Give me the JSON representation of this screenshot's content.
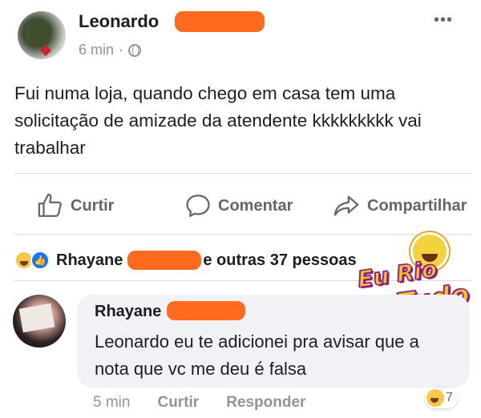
{
  "post": {
    "author": "Leonardo",
    "time": "6 min",
    "separator": "·",
    "more": "•••",
    "text": "Fui numa loja, quando chego em casa tem uma solicitação de amizade da atendente kkkkkkkkk vai trabalhar"
  },
  "actions": {
    "like": "Curtir",
    "comment": "Comentar",
    "share": "Compartilhar"
  },
  "reactions": {
    "name": "Rhayane",
    "others": "e outras 37 pessoas"
  },
  "watermark": {
    "line1": "Eu Rio",
    "line2": "De Tudo"
  },
  "comment": {
    "author": "Rhayane",
    "text": "Leonardo eu te adicionei pra avisar que a nota que vc me deu é falsa",
    "time": "5 min",
    "like": "Curtir",
    "reply": "Responder",
    "reaction_count": "7"
  },
  "colors": {
    "redaction": "#ff6a1f",
    "muted": "#606770",
    "like_blue": "#1877f2",
    "bubble": "#f0f2f5"
  }
}
